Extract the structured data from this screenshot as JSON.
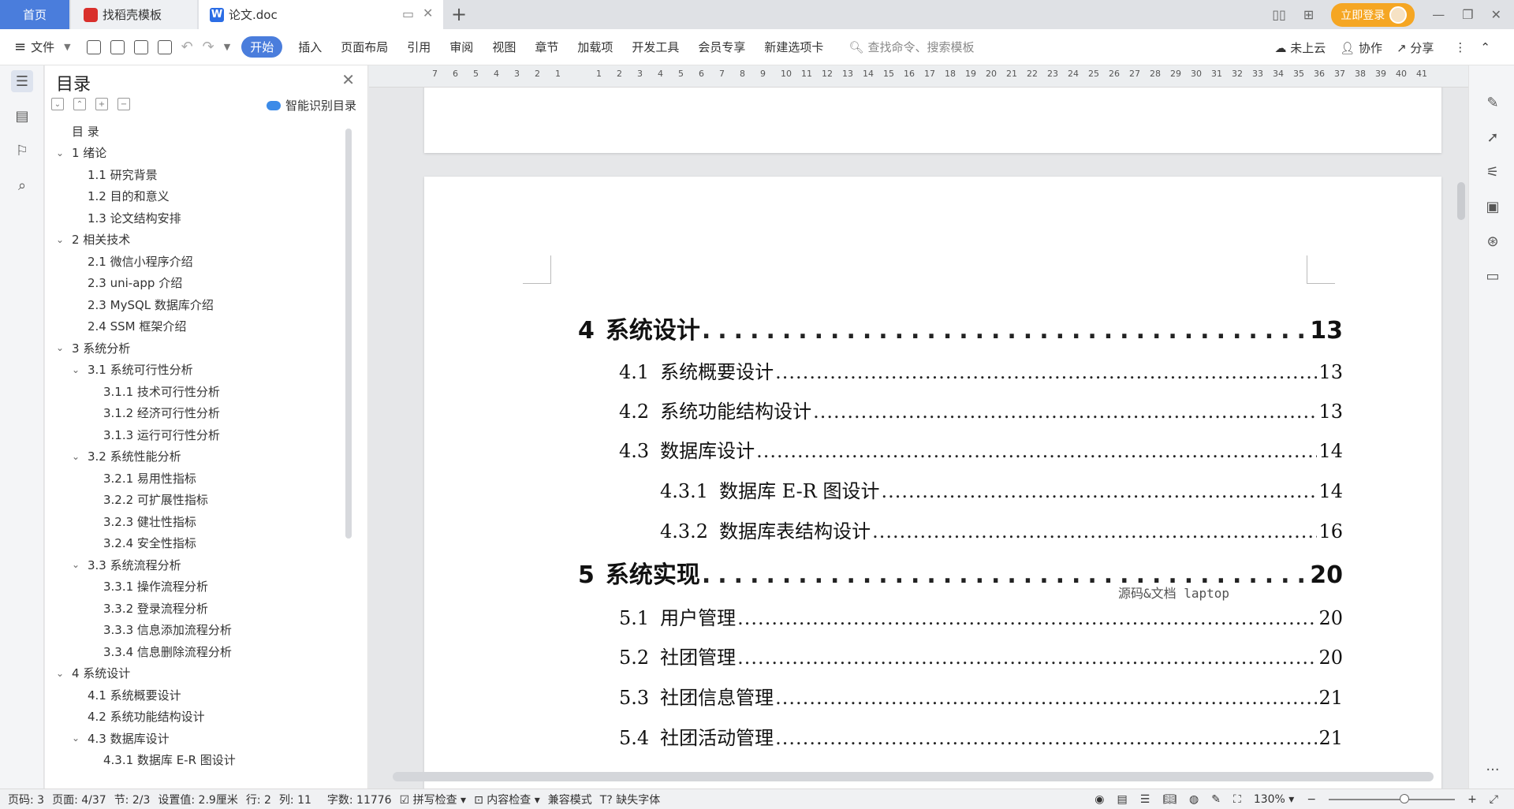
{
  "tabs": {
    "home": "首页",
    "template": "找稻壳模板",
    "document": "论文.doc"
  },
  "window": {
    "login": "立即登录"
  },
  "ribbon": {
    "file": "文件",
    "items": [
      "开始",
      "插入",
      "页面布局",
      "引用",
      "审阅",
      "视图",
      "章节",
      "加载项",
      "开发工具",
      "会员专享",
      "新建选项卡"
    ],
    "search_placeholder": "查找命令、搜索模板",
    "cloud": "未上云",
    "collab": "协作",
    "share": "分享"
  },
  "toc_pane": {
    "title": "目录",
    "ai_toc": "智能识别目录",
    "items": [
      {
        "label": "目 录",
        "level": 0,
        "expandable": false
      },
      {
        "label": "1 绪论",
        "level": 1,
        "expandable": true
      },
      {
        "label": "1.1  研究背景",
        "level": 2,
        "expandable": false
      },
      {
        "label": "1.2  目的和意义",
        "level": 2,
        "expandable": false
      },
      {
        "label": "1.3  论文结构安排",
        "level": 2,
        "expandable": false
      },
      {
        "label": "2 相关技术",
        "level": 1,
        "expandable": true
      },
      {
        "label": "2.1  微信小程序介绍",
        "level": 2,
        "expandable": false
      },
      {
        "label": "2.3 uni-app 介绍",
        "level": 2,
        "expandable": false
      },
      {
        "label": "2.3 MySQL 数据库介绍",
        "level": 2,
        "expandable": false
      },
      {
        "label": "2.4 SSM 框架介绍",
        "level": 2,
        "expandable": false
      },
      {
        "label": "3 系统分析",
        "level": 1,
        "expandable": true
      },
      {
        "label": "3.1  系统可行性分析",
        "level": 2,
        "expandable": true
      },
      {
        "label": "3.1.1  技术可行性分析",
        "level": 3,
        "expandable": false
      },
      {
        "label": "3.1.2  经济可行性分析",
        "level": 3,
        "expandable": false
      },
      {
        "label": "3.1.3  运行可行性分析",
        "level": 3,
        "expandable": false
      },
      {
        "label": "3.2  系统性能分析",
        "level": 2,
        "expandable": true
      },
      {
        "label": "3.2.1  易用性指标",
        "level": 3,
        "expandable": false
      },
      {
        "label": "3.2.2  可扩展性指标",
        "level": 3,
        "expandable": false
      },
      {
        "label": "3.2.3  健壮性指标",
        "level": 3,
        "expandable": false
      },
      {
        "label": "3.2.4  安全性指标",
        "level": 3,
        "expandable": false
      },
      {
        "label": "3.3  系统流程分析",
        "level": 2,
        "expandable": true
      },
      {
        "label": "3.3.1  操作流程分析",
        "level": 3,
        "expandable": false
      },
      {
        "label": "3.3.2  登录流程分析",
        "level": 3,
        "expandable": false
      },
      {
        "label": "3.3.3  信息添加流程分析",
        "level": 3,
        "expandable": false
      },
      {
        "label": "3.3.4  信息删除流程分析",
        "level": 3,
        "expandable": false
      },
      {
        "label": "4 系统设计",
        "level": 1,
        "expandable": true
      },
      {
        "label": "4.1  系统概要设计",
        "level": 2,
        "expandable": false
      },
      {
        "label": "4.2  系统功能结构设计",
        "level": 2,
        "expandable": false
      },
      {
        "label": "4.3  数据库设计",
        "level": 2,
        "expandable": true
      },
      {
        "label": "4.3.1  数据库 E-R 图设计",
        "level": 3,
        "expandable": false
      }
    ]
  },
  "ruler_ticks": [
    "7",
    "6",
    "5",
    "4",
    "3",
    "2",
    "1",
    "",
    "1",
    "2",
    "3",
    "4",
    "5",
    "6",
    "7",
    "8",
    "9",
    "10",
    "11",
    "12",
    "13",
    "14",
    "15",
    "16",
    "17",
    "18",
    "19",
    "20",
    "21",
    "22",
    "23",
    "24",
    "25",
    "26",
    "27",
    "28",
    "29",
    "30",
    "31",
    "32",
    "33",
    "34",
    "35",
    "36",
    "37",
    "38",
    "39",
    "40",
    "41"
  ],
  "document": {
    "toc_lines": [
      {
        "num": "4",
        "text": "系统设计",
        "page": "13",
        "level": 1
      },
      {
        "num": "4.1",
        "text": "系统概要设计",
        "page": "13",
        "level": 2
      },
      {
        "num": "4.2",
        "text": "系统功能结构设计",
        "page": "13",
        "level": 2
      },
      {
        "num": "4.3",
        "text": "数据库设计",
        "page": "14",
        "level": 2
      },
      {
        "num": "4.3.1",
        "text": "数据库 E-R 图设计",
        "page": "14",
        "level": 3
      },
      {
        "num": "4.3.2",
        "text": "数据库表结构设计",
        "page": "16",
        "level": 3
      },
      {
        "num": "5",
        "text": "系统实现",
        "page": "20",
        "level": 1
      },
      {
        "num": "5.1",
        "text": "用户管理",
        "page": "20",
        "level": 2
      },
      {
        "num": "5.2",
        "text": "社团管理",
        "page": "20",
        "level": 2
      },
      {
        "num": "5.3",
        "text": "社团信息管理",
        "page": "21",
        "level": 2
      },
      {
        "num": "5.4",
        "text": "社团活动管理",
        "page": "21",
        "level": 2
      }
    ],
    "overlay": "源码&文档 laptop"
  },
  "statusbar": {
    "page_num": "页码: 3",
    "page": "页面: 4/37",
    "section": "节: 2/3",
    "setting": "设置值: 2.9厘米",
    "row": "行: 2",
    "col": "列: 11",
    "words": "字数: 11776",
    "spell": "拼写检查",
    "content_check": "内容检查",
    "compat": "兼容模式",
    "missing_font": "缺失字体",
    "zoom": "130%"
  }
}
